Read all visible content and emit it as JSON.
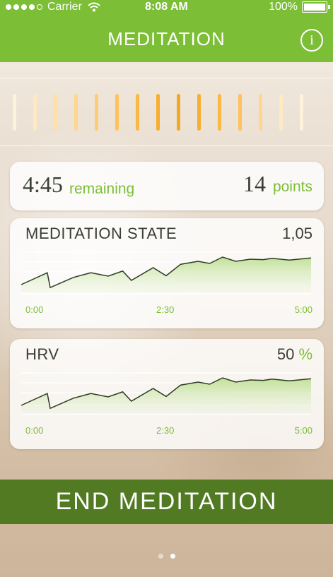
{
  "status_bar": {
    "carrier": "Carrier",
    "time": "8:08 AM",
    "battery": "100%"
  },
  "header": {
    "title": "MEDITATION",
    "info_icon": "info-icon"
  },
  "meter": {
    "colors": [
      "#fff2dc",
      "#ffe9c2",
      "#ffe0a8",
      "#ffd68e",
      "#ffcc72",
      "#ffc25a",
      "#fbb843",
      "#f8ae30",
      "#f5a623",
      "#f8ae30",
      "#fbb843",
      "#ffc25a",
      "#ffd68e",
      "#ffe9c2",
      "#fff2dc"
    ]
  },
  "summary": {
    "time": "4:45",
    "time_label": "remaining",
    "points": "14",
    "points_label": "points"
  },
  "meditation_chart": {
    "label": "MEDITATION STATE",
    "value": "1,05"
  },
  "hrv_chart": {
    "label": "HRV",
    "value": "50",
    "unit": "%"
  },
  "time_axis": {
    "start": "0:00",
    "mid": "2:30",
    "end": "5:00"
  },
  "chart_data": [
    {
      "type": "area",
      "title": "MEDITATION STATE",
      "x": [
        0,
        18,
        20,
        36,
        48,
        60,
        70,
        76,
        91,
        100,
        110,
        122,
        130,
        139,
        148,
        158,
        167,
        173,
        185,
        200
      ],
      "values": [
        0.2,
        0.48,
        0.13,
        0.37,
        0.48,
        0.4,
        0.52,
        0.3,
        0.6,
        0.41,
        0.68,
        0.75,
        0.7,
        0.85,
        0.75,
        0.8,
        0.79,
        0.82,
        0.78,
        0.83
      ],
      "xticks": [
        "0:00",
        "2:30",
        "5:00"
      ],
      "ylim": [
        0,
        1
      ]
    },
    {
      "type": "area",
      "title": "HRV",
      "x": [
        0,
        18,
        20,
        36,
        48,
        60,
        70,
        76,
        91,
        100,
        110,
        122,
        130,
        139,
        148,
        158,
        167,
        173,
        185,
        200
      ],
      "values": [
        0.2,
        0.48,
        0.13,
        0.37,
        0.48,
        0.4,
        0.52,
        0.3,
        0.6,
        0.41,
        0.68,
        0.75,
        0.7,
        0.85,
        0.75,
        0.8,
        0.79,
        0.82,
        0.78,
        0.83
      ],
      "xticks": [
        "0:00",
        "2:30",
        "5:00"
      ],
      "ylim": [
        0,
        1
      ]
    }
  ],
  "end_button": {
    "label": "END MEDITATION"
  },
  "pager": {
    "pages": 2,
    "current": 2
  }
}
